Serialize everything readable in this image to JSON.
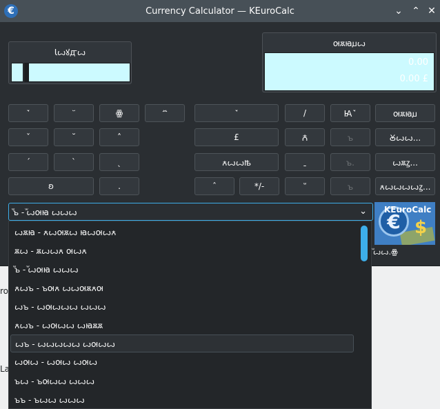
{
  "window": {
    "title": "Currency Calculator — KEuroCalc"
  },
  "background": {
    "fragment_1": "ro",
    "fragment_2": "La"
  },
  "input_panel": {
    "label": "Ꙇꙍꙋꙣꙍ",
    "value": ""
  },
  "output_panel": {
    "label": "ꙕꙛꙗꙡꙍ",
    "line1": "0.00",
    "line2": "0.00 £"
  },
  "keypad": {
    "row1": [
      "ꙿ",
      "꙾",
      "ꙮ",
      "꙯꙼"
    ],
    "row2": [
      "ˇ",
      "˘",
      "˄"
    ],
    "row3": [
      "ˊ",
      "ˋ",
      "ˎ"
    ],
    "row4": [
      "ʚ",
      "."
    ]
  },
  "ops": {
    "row1": [
      "꙽",
      "/",
      "Ꙗꙿ",
      "ꙕꙛꙗꙡ"
    ],
    "row2": [
      "£",
      "Ꙉ",
      "ꙏ",
      "Ꙋꙍꙍ..."
    ],
    "row3": [
      "ꙉꙍꙍꙓ",
      "ˍ",
      "ꙏ.",
      "ꙍꙛꙁ..."
    ],
    "row4": [
      "ˆ",
      "*/-",
      "ꙻ",
      "ꙏ",
      "ꙉꙍꙍꙍꙍꙁ..."
    ]
  },
  "currency_select": {
    "selected": "ꙻꙏ - ꙻꙍꙕꙗ ꙍꙍꙍ"
  },
  "logo": {
    "text": "KEuroCalc"
  },
  "rate_text": "ꙻꙍꙍ.ꙮ",
  "dropdown": {
    "items": [
      "ꙍꙛꙗ - ꙉꙍꙕꙛꙍ ꙗꙍꙕꙍꙉ",
      "ꙛꙍ - ꙛꙍꙍꙉ ꙕꙍꙉ",
      "ꙻꙏ - ꙻꙍꙕꙗ ꙍꙍꙍ",
      "ꙉꙍꙏ - ꙏꙕꙉ ꙍꙍꙕꙛꙉꙕ",
      "ꙍꙏ - ꙍꙕꙍꙍꙍ ꙍꙍꙍ",
      "ꙉꙍꙏ - ꙍꙕꙍꙍ ꙍꙗꙛꙛ",
      "ꙍꙏ - ꙍꙍꙍꙍꙍ ꙍꙕꙍꙍ",
      "ꙍꙕꙍ - ꙍꙕꙍ ꙍꙕꙍ",
      "ꙏꙍ - ꙏꙕꙍꙍ ꙍꙍꙍ",
      "ꙏꙏ - ꙏꙍꙍ ꙍꙍꙍ"
    ],
    "selected_index": 6
  },
  "colors": {
    "accent": "#3daee9",
    "lcd": "#ccfaff",
    "window": "#2a2e32",
    "titlebar": "#475057"
  }
}
